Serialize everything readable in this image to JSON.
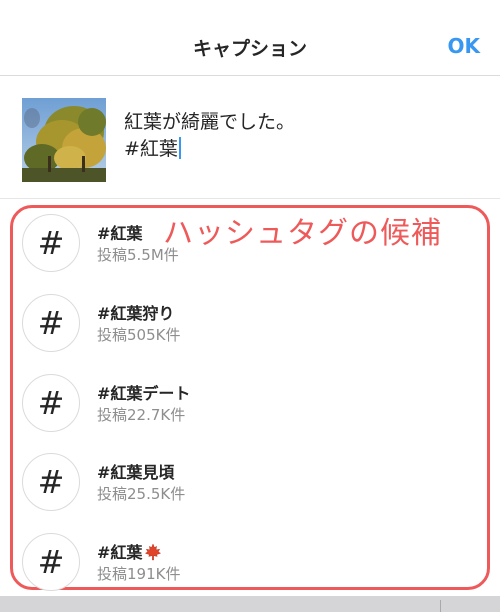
{
  "header": {
    "title": "キャプション",
    "ok_label": "OK"
  },
  "caption": {
    "line1": "紅葉が綺麗でした。",
    "line2": "#紅葉"
  },
  "annotation": "ハッシュタグの候補",
  "suggestions": [
    {
      "name": "#紅葉",
      "count": "投稿5.5M件"
    },
    {
      "name": "#紅葉狩り",
      "count": "投稿505K件"
    },
    {
      "name": "#紅葉デート",
      "count": "投稿22.7K件"
    },
    {
      "name": "#紅葉見頃",
      "count": "投稿25.5K件"
    },
    {
      "name": "#紅葉",
      "count": "投稿191K件",
      "emoji": "maple-leaf-icon"
    }
  ],
  "hash_symbol": "#",
  "colors": {
    "accent": "#3897f0",
    "annotation": "#ee5a5a",
    "muted": "#8e8e8e"
  }
}
